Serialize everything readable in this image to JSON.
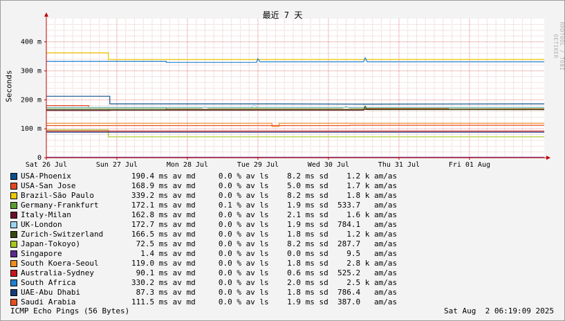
{
  "chart_data": {
    "type": "line",
    "title": "最近 7 天",
    "ylabel": "Seconds",
    "watermark": "RRDTOOL / TOBI OETIKER",
    "y_ticks": [
      {
        "value": 0,
        "label": "0"
      },
      {
        "value": 100,
        "label": "100 m"
      },
      {
        "value": 200,
        "label": "200 m"
      },
      {
        "value": 300,
        "label": "300 m"
      },
      {
        "value": 400,
        "label": "400 m"
      }
    ],
    "ylim": [
      0,
      480
    ],
    "x_ticks": [
      {
        "value": 0,
        "label": "Sat 26 Jul"
      },
      {
        "value": 1,
        "label": "Sun 27 Jul"
      },
      {
        "value": 2,
        "label": "Mon 28 Jul"
      },
      {
        "value": 3,
        "label": "Tue 29 Jul"
      },
      {
        "value": 4,
        "label": "Wed 30 Jul"
      },
      {
        "value": 5,
        "label": "Thu 31 Jul"
      },
      {
        "value": 6,
        "label": "Fri 01 Aug"
      }
    ],
    "xlim": [
      0,
      7.06
    ],
    "grid": true,
    "series": [
      {
        "name": "USA-Phoenix",
        "color": "#0b4f8c",
        "stats": "190.4 ms av md     0.0 % av ls    8.2 ms sd    1.2 k am/as",
        "points": [
          [
            0,
            212
          ],
          [
            0.9,
            212
          ],
          [
            0.9,
            186
          ],
          [
            3.2,
            186
          ],
          [
            4.5,
            185
          ],
          [
            7.06,
            186
          ]
        ]
      },
      {
        "name": "USA-San Jose",
        "color": "#e8461e",
        "stats": "168.9 ms av md     0.0 % av ls    5.0 ms sd    1.7 k am/as",
        "points": [
          [
            0,
            180
          ],
          [
            0.6,
            180
          ],
          [
            0.6,
            172
          ],
          [
            1.7,
            172
          ],
          [
            1.7,
            167
          ],
          [
            4.5,
            167
          ],
          [
            4.6,
            170
          ],
          [
            5.7,
            170
          ],
          [
            5.7,
            167
          ],
          [
            7.06,
            168
          ]
        ]
      },
      {
        "name": "Brazil-São Paulo",
        "color": "#f0c800",
        "stats": "339.2 ms av md     0.0 % av ls    8.2 ms sd    1.8 k am/as",
        "points": [
          [
            0,
            362
          ],
          [
            0.88,
            362
          ],
          [
            0.88,
            339
          ],
          [
            7.06,
            339
          ]
        ]
      },
      {
        "name": "Germany-Frankfurt",
        "color": "#5a9e2f",
        "stats": "172.1 ms av md     0.1 % av ls    1.9 ms sd  533.7   am/as",
        "points": [
          [
            0,
            172
          ],
          [
            2.2,
            172
          ],
          [
            2.25,
            175
          ],
          [
            2.3,
            172
          ],
          [
            4.2,
            172
          ],
          [
            4.25,
            176
          ],
          [
            4.3,
            172
          ],
          [
            7.06,
            172
          ]
        ]
      },
      {
        "name": "Italy-Milan",
        "color": "#6e0f2a",
        "stats": "162.8 ms av md     0.0 % av ls    2.1 ms sd    1.6 k am/as",
        "points": [
          [
            0,
            163
          ],
          [
            0.9,
            163
          ],
          [
            0.9,
            164
          ],
          [
            4.5,
            164
          ],
          [
            4.5,
            167
          ],
          [
            7.06,
            166
          ]
        ]
      },
      {
        "name": "UK-London",
        "color": "#9ed3f5",
        "stats": "172.7 ms av md     0.0 % av ls    1.9 ms sd  784.1   am/as",
        "points": [
          [
            0,
            174
          ],
          [
            2.9,
            174
          ],
          [
            2.95,
            181
          ],
          [
            3.0,
            174
          ],
          [
            7.06,
            174
          ]
        ]
      },
      {
        "name": "Zurich-Switzerland",
        "color": "#374a0f",
        "stats": "166.5 ms av md     0.0 % av ls    1.8 ms sd    1.2 k am/as",
        "points": [
          [
            0,
            166
          ],
          [
            4.5,
            166
          ],
          [
            4.52,
            178
          ],
          [
            4.55,
            166
          ],
          [
            7.06,
            166
          ]
        ]
      },
      {
        "name": "Japan-Tokoyo)",
        "color": "#a7c81c",
        "stats": " 72.5 ms av md     0.0 % av ls    8.2 ms sd  287.7   am/as",
        "points": [
          [
            0,
            96
          ],
          [
            0.88,
            96
          ],
          [
            0.88,
            72
          ],
          [
            7.06,
            72
          ]
        ]
      },
      {
        "name": "Singapore",
        "color": "#5c2a8f",
        "stats": "  1.4 ms av md     0.0 % av ls    0.0 ms sd    9.5   am/as",
        "points": [
          [
            0,
            1.4
          ],
          [
            7.06,
            1.4
          ]
        ]
      },
      {
        "name": "South Koera-Seoul",
        "color": "#f08c1e",
        "stats": "119.0 ms av md     0.0 % av ls    1.8 ms sd    2.8 k am/as",
        "points": [
          [
            0,
            119
          ],
          [
            3.2,
            119
          ],
          [
            3.2,
            108
          ],
          [
            3.3,
            108
          ],
          [
            3.3,
            119
          ],
          [
            7.06,
            119
          ]
        ]
      },
      {
        "name": "Australia-Sydney",
        "color": "#c8141e",
        "stats": " 90.1 ms av md     0.0 % av ls    0.6 ms sd  525.2   am/as",
        "points": [
          [
            0,
            92
          ],
          [
            7.06,
            92
          ]
        ]
      },
      {
        "name": "South Africa",
        "color": "#1f7fd0",
        "stats": "330.2 ms av md     0.0 % av ls    2.0 ms sd    2.5 k am/as",
        "points": [
          [
            0,
            333
          ],
          [
            1.7,
            333
          ],
          [
            1.7,
            329
          ],
          [
            2.98,
            329
          ],
          [
            3.0,
            342
          ],
          [
            3.03,
            331
          ],
          [
            4.5,
            331
          ],
          [
            4.52,
            345
          ],
          [
            4.55,
            331
          ],
          [
            7.06,
            331
          ]
        ]
      },
      {
        "name": "UAE-Abu Dhabi",
        "color": "#163b78",
        "stats": " 87.3 ms av md     0.0 % av ls    1.8 ms sd  786.4   am/as",
        "points": [
          [
            0,
            88
          ],
          [
            7.06,
            88
          ]
        ]
      },
      {
        "name": "Saudi Arabia",
        "color": "#e84f1e",
        "stats": "111.5 ms av md     0.0 % av ls    1.9 ms sd  387.0   am/as",
        "points": [
          [
            0,
            111
          ],
          [
            4.3,
            111
          ],
          [
            4.3,
            112
          ],
          [
            7.06,
            112
          ]
        ]
      }
    ]
  },
  "footer": {
    "left": "ICMP Echo Pings (56 Bytes)",
    "right": "Sat Aug  2 06:19:09 2025"
  }
}
